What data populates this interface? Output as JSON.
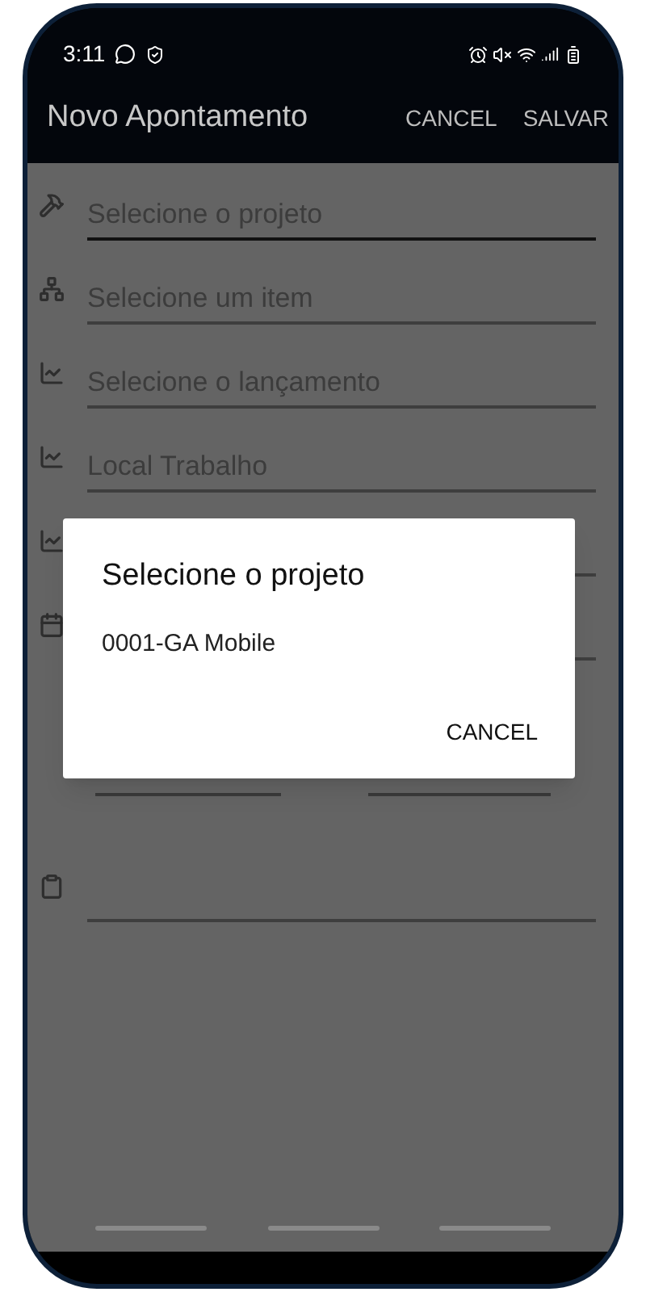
{
  "status_bar": {
    "time": "3:11"
  },
  "app_bar": {
    "title": "Novo Apontamento",
    "actions": [
      "CANCEL",
      "SALVAR"
    ]
  },
  "form": {
    "fields": [
      {
        "kind": "text",
        "placeholder": "Selecione o projeto",
        "focused": true
      },
      {
        "kind": "text",
        "placeholder": "Selecione um item",
        "focused": false
      },
      {
        "kind": "text",
        "placeholder": "Selecione o lançamento",
        "focused": false
      },
      {
        "kind": "text",
        "placeholder": "Local Trabalho",
        "focused": false
      },
      {
        "kind": "text",
        "focused": false
      },
      {
        "kind": "text",
        "focused": false
      },
      {
        "kind": "pair"
      },
      {
        "kind": "tall",
        "focused": false
      }
    ]
  },
  "dialog": {
    "title": "Selecione o projeto",
    "options": [
      "0001-GA Mobile"
    ],
    "buttons": [
      "CANCEL"
    ]
  }
}
